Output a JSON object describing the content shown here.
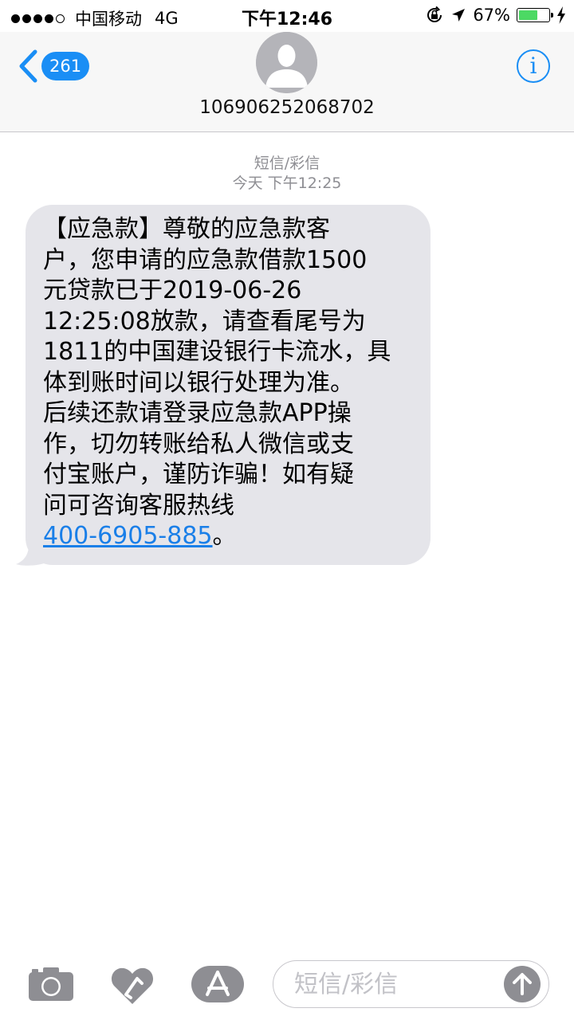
{
  "status_bar": {
    "carrier": "中国移动",
    "network": "4G",
    "time": "下午12:46",
    "battery_percent": "67%",
    "battery_level": 0.67,
    "icons": [
      "signal-dots",
      "lock-rotation-icon",
      "location-arrow-icon",
      "battery-icon",
      "charging-bolt-icon"
    ]
  },
  "header": {
    "unread_count": "261",
    "contact": "106906252068702",
    "icons": [
      "back-chevron-icon",
      "contact-avatar-icon",
      "info-icon"
    ]
  },
  "conversation": {
    "service_label": "短信/彩信",
    "timestamp": "今天 下午12:25",
    "message": {
      "text": "【应急款】尊敬的应急款客\n户，您申请的应急款借款1500\n元贷款已于2019-06-26\n12:25:08放款，请查看尾号为\n1811的中国建设银行卡流水，具\n体到账时间以银行处理为准。\n后续还款请登录应急款APP操\n作，切勿转账给私人微信或支\n付宝账户，谨防诈骗！如有疑\n问可咨询客服热线\n",
      "phone_link": "400-6905-885",
      "end_punct": "。"
    }
  },
  "input_bar": {
    "placeholder": "短信/彩信",
    "value": "",
    "icons": [
      "camera-icon",
      "digital-touch-icon",
      "app-store-icon",
      "send-arrow-icon"
    ]
  },
  "colors": {
    "accent": "#1a8ef5",
    "bubble": "#e5e5ea",
    "meta_text": "#8e8e93",
    "battery_fill": "#4cd964"
  }
}
